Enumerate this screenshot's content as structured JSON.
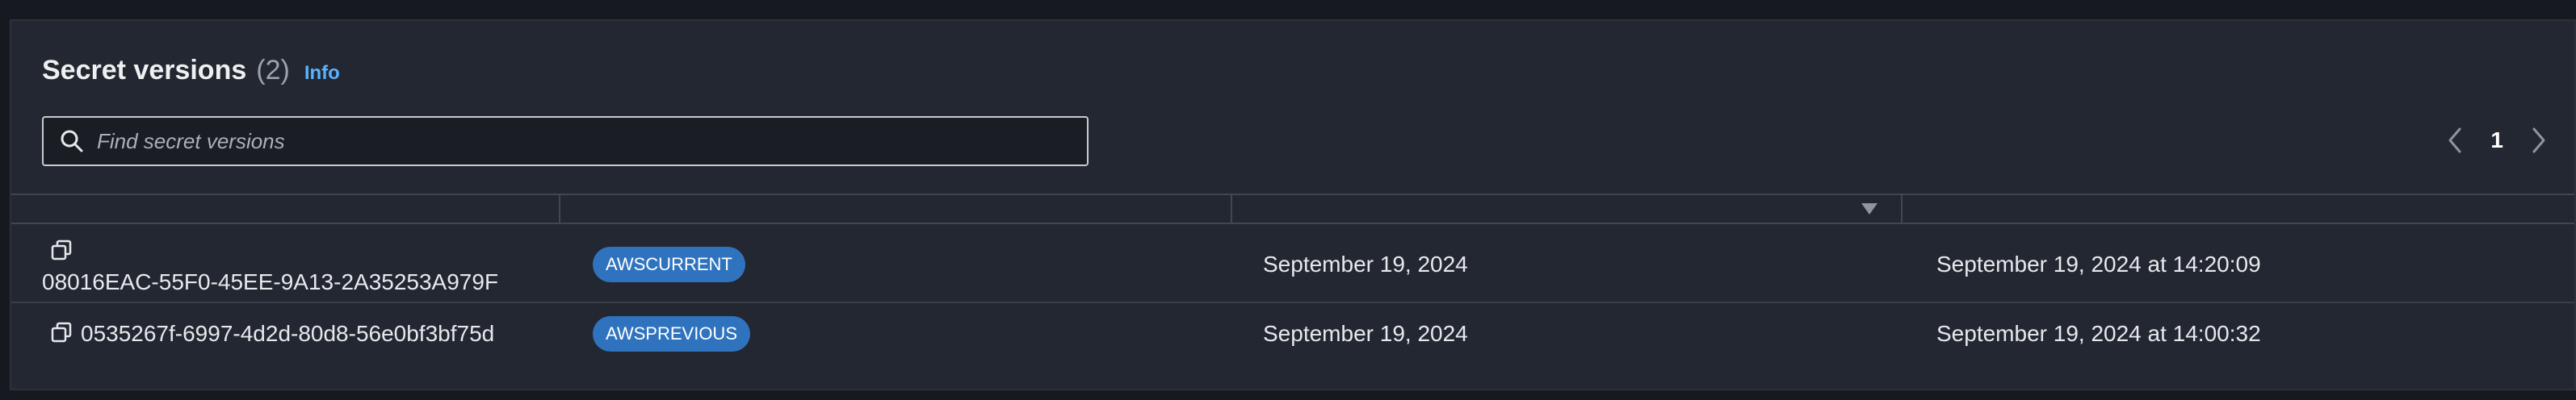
{
  "header": {
    "title": "Secret versions",
    "count": "(2)",
    "info_label": "Info"
  },
  "search": {
    "placeholder": "Find secret versions",
    "value": ""
  },
  "pagination": {
    "current_page": "1"
  },
  "icons": {
    "search": "search-icon",
    "copy": "copy-icon",
    "prev": "chevron-left-icon",
    "next": "chevron-right-icon",
    "sort": "sort-descending-icon"
  },
  "colors": {
    "badge": "#2f73bf",
    "link": "#5ab2ff"
  },
  "versions": [
    {
      "version_id": "08016EAC-55F0-45EE-9A13-2A35253A979F",
      "staging_label": "AWSCURRENT",
      "date": "September 19, 2024",
      "last_accessed": "September 19, 2024 at 14:20:09"
    },
    {
      "version_id": "0535267f-6997-4d2d-80d8-56e0bf3bf75d",
      "staging_label": "AWSPREVIOUS",
      "date": "September 19, 2024",
      "last_accessed": "September 19, 2024 at 14:00:32"
    }
  ]
}
